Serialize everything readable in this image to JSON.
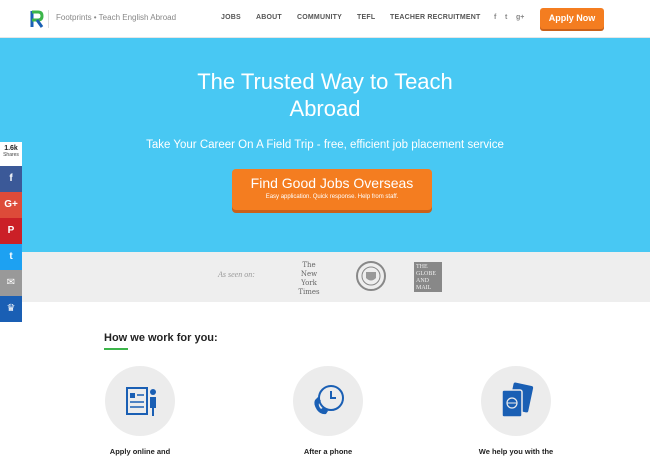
{
  "header": {
    "logo_letter": "R",
    "tagline": "Footprints • Teach English Abroad",
    "nav": [
      "JOBS",
      "ABOUT",
      "COMMUNITY",
      "TEFL",
      "TEACHER RECRUITMENT"
    ],
    "social": [
      "f",
      "t",
      "g+"
    ],
    "apply_label": "Apply Now"
  },
  "hero": {
    "title_line1": "The Trusted Way to Teach",
    "title_line2": "Abroad",
    "subtitle": "Take Your Career On A Field Trip - free, efficient job placement service",
    "cta_label": "Find Good Jobs Overseas",
    "cta_sub": "Easy application. Quick response. Help from staff."
  },
  "press": {
    "label": "As seen on:",
    "nyt": [
      "The",
      "New York",
      "Times"
    ],
    "globe": [
      "THE",
      "GLOBE",
      "AND",
      "MAIL"
    ]
  },
  "how": {
    "title": "How we work for you:",
    "steps": [
      {
        "text": "Apply online and",
        "icon": "resume-icon"
      },
      {
        "text": "After a phone",
        "icon": "phone-icon"
      },
      {
        "text": "We help you with the",
        "icon": "passport-icon"
      }
    ]
  },
  "share": {
    "count": "1.6k",
    "label": "Shares",
    "buttons": [
      {
        "icon": "facebook-icon",
        "glyph": "f",
        "color": "#3b5998"
      },
      {
        "icon": "google-plus-icon",
        "glyph": "G+",
        "color": "#dd4b39"
      },
      {
        "icon": "pinterest-icon",
        "glyph": "P",
        "color": "#cb2027"
      },
      {
        "icon": "twitter-icon",
        "glyph": "t",
        "color": "#1da1f2"
      },
      {
        "icon": "email-icon",
        "glyph": "✉",
        "color": "#999999"
      },
      {
        "icon": "crown-icon",
        "glyph": "♛",
        "color": "#1a5fb4"
      }
    ]
  },
  "colors": {
    "hero_bg": "#48c8f3",
    "accent": "#f47d20",
    "green": "#3cb54a"
  }
}
